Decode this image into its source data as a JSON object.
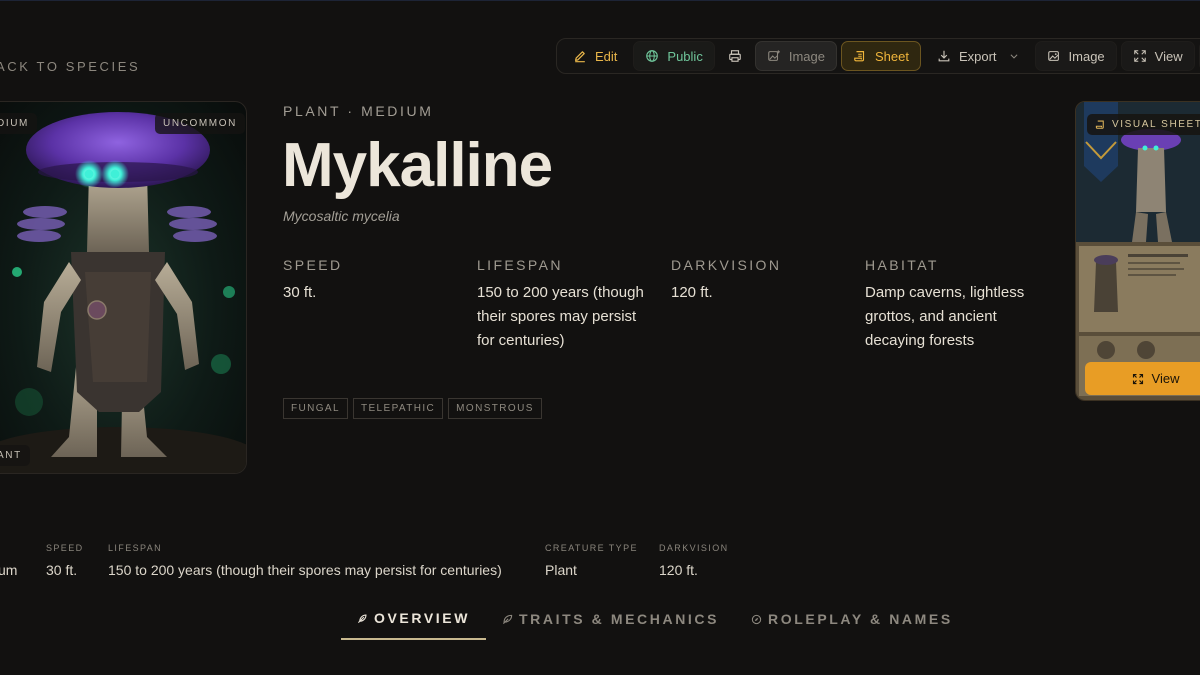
{
  "nav": {
    "back_label": "ACK TO SPECIES"
  },
  "toolbar": {
    "edit": "Edit",
    "public": "Public",
    "image": "Image",
    "sheet": "Sheet",
    "export": "Export",
    "image2": "Image",
    "view": "View"
  },
  "portrait": {
    "size_badge": "DIUM",
    "rarity_badge": "UNCOMMON",
    "type_badge": "ANT"
  },
  "species": {
    "kicker": "PLANT · MEDIUM",
    "name": "Mykalline",
    "scientific": "Mycosaltic mycelia"
  },
  "stats": [
    {
      "label": "SPEED",
      "value": "30 ft."
    },
    {
      "label": "LIFESPAN",
      "value": "150 to 200 years (though their spores may persist for centuries)"
    },
    {
      "label": "DARKVISION",
      "value": "120 ft."
    },
    {
      "label": "HABITAT",
      "value": "Damp caverns, lightless grottos, and ancient decaying forests"
    }
  ],
  "tags": [
    "FUNGAL",
    "TELEPATHIC",
    "MONSTROUS"
  ],
  "sheet_preview": {
    "badge": "VISUAL SHEET",
    "view": "View"
  },
  "quick_stats": [
    {
      "label": "",
      "value": "um"
    },
    {
      "label": "SPEED",
      "value": "30 ft."
    },
    {
      "label": "LIFESPAN",
      "value": "150 to 200 years (though their spores may persist for centuries)"
    },
    {
      "label": "CREATURE TYPE",
      "value": "Plant"
    },
    {
      "label": "DARKVISION",
      "value": "120 ft."
    }
  ],
  "tabs": [
    {
      "label": "OVERVIEW",
      "active": true
    },
    {
      "label": "TRAITS & MECHANICS",
      "active": false
    },
    {
      "label": "ROLEPLAY & NAMES",
      "active": false
    }
  ],
  "colors": {
    "background": "#121110",
    "accent": "#e89d25",
    "public_green": "#6fc59a",
    "mushroom_purple": "#6a3fb4",
    "eye_glow": "#3ff0d8"
  }
}
